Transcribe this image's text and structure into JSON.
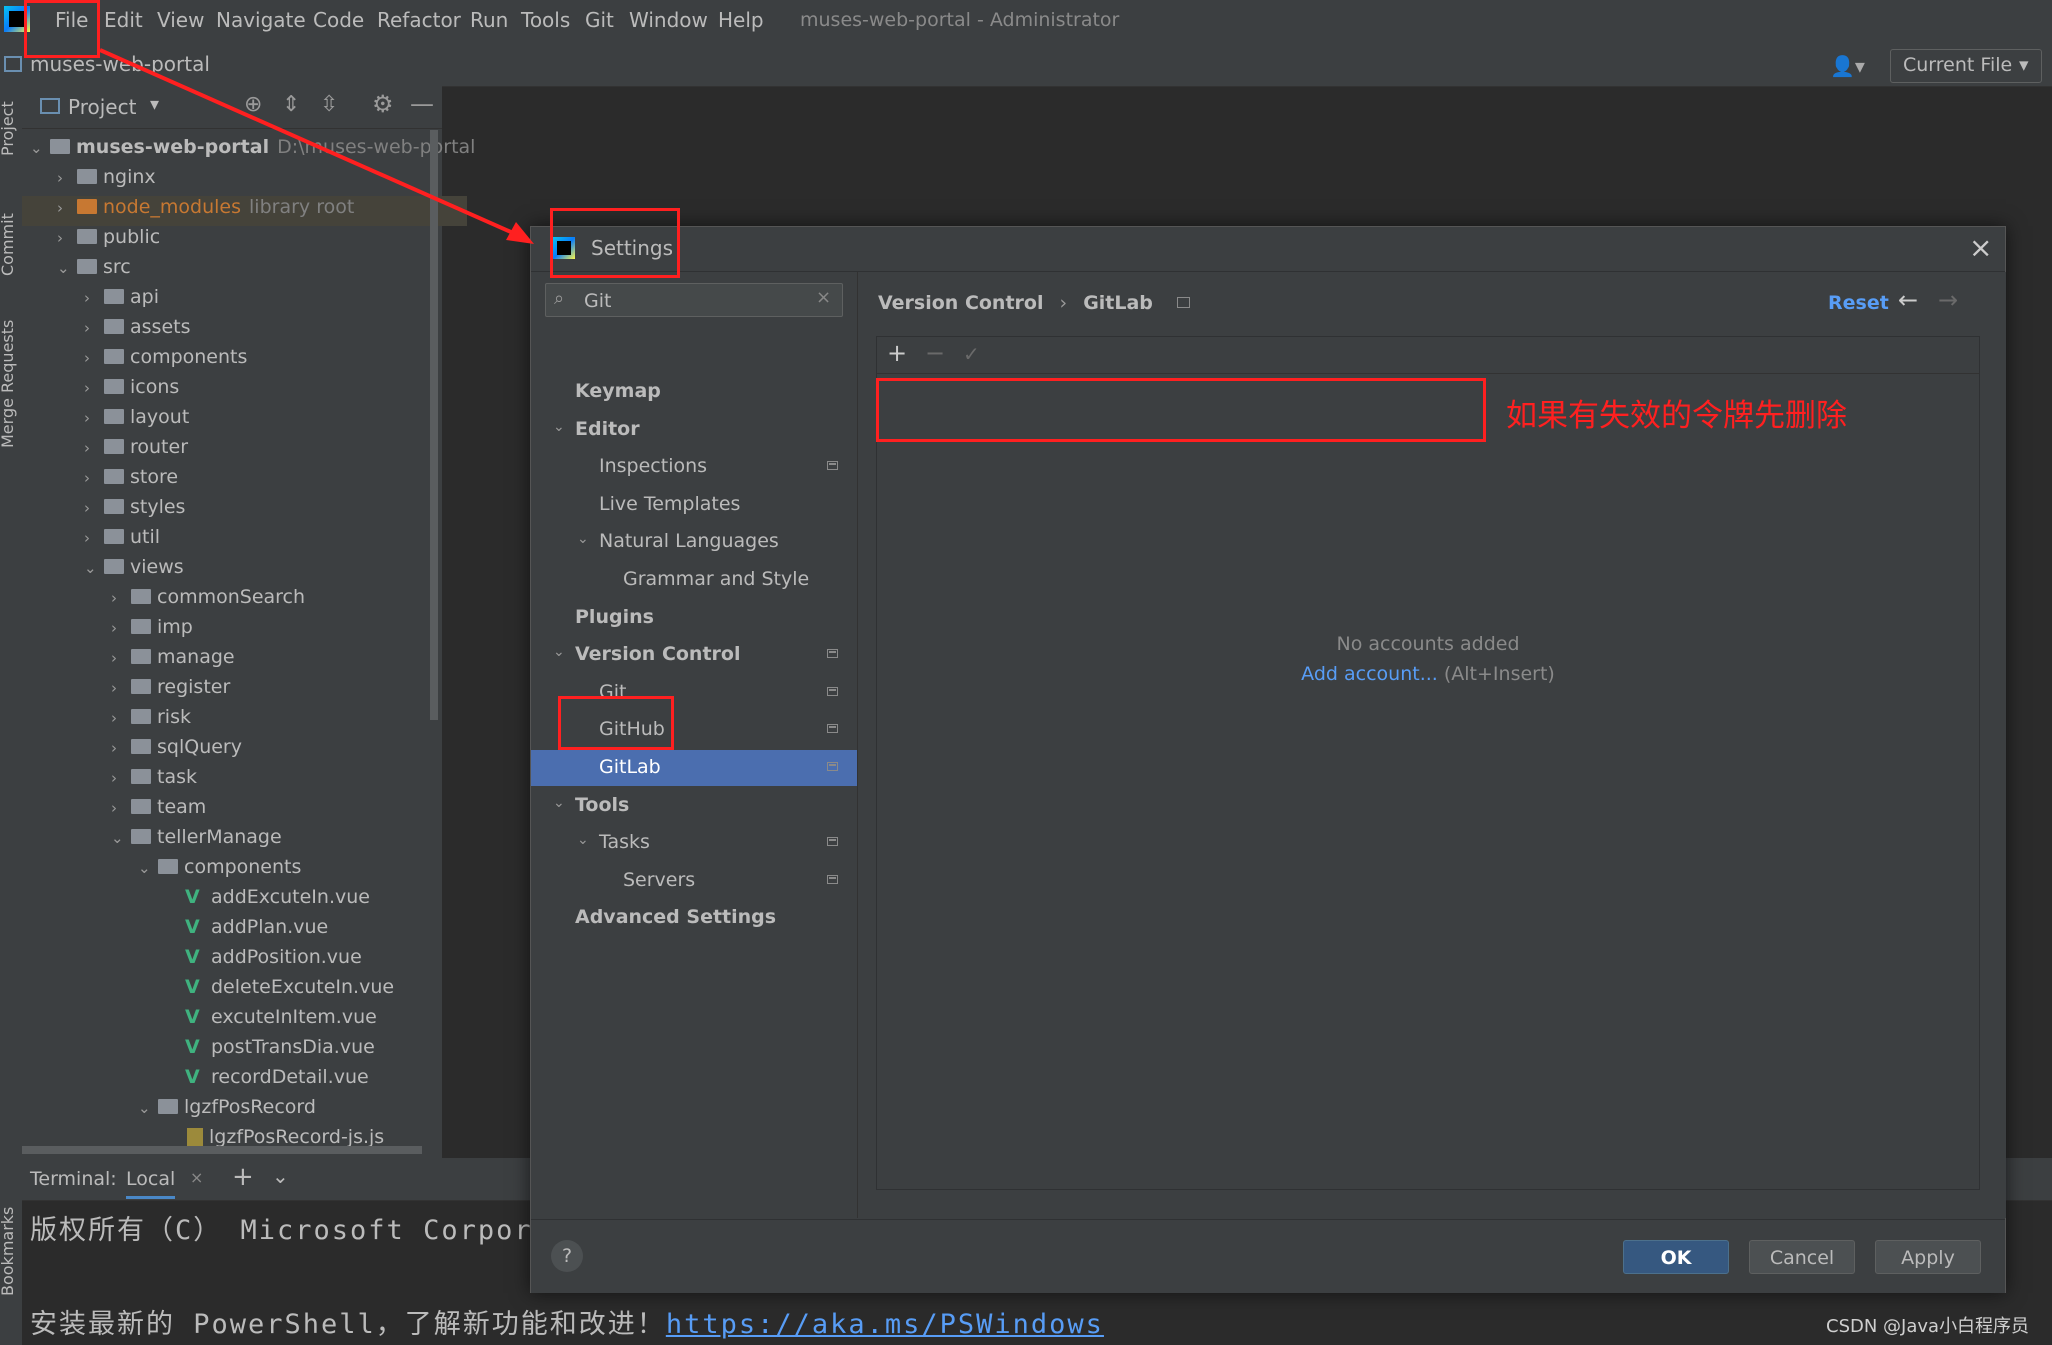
{
  "menubar": {
    "items": [
      "File",
      "Edit",
      "View",
      "Navigate",
      "Code",
      "Refactor",
      "Run",
      "Tools",
      "Git",
      "Window",
      "Help"
    ],
    "window_title": "muses-web-portal - Administrator"
  },
  "navbar": {
    "project": "muses-web-portal",
    "run_config": "Current File"
  },
  "toolstrip": {
    "tabs": [
      "Project",
      "Commit",
      "Merge Requests",
      "Bookmarks"
    ]
  },
  "project_panel": {
    "title": "Project",
    "tree": [
      {
        "label": "muses-web-portal",
        "hint": "D:\\muses-web-portal",
        "type": "folder",
        "expanded": true,
        "bold": true
      },
      {
        "label": "nginx",
        "type": "folder"
      },
      {
        "label": "node_modules",
        "hint": "library root",
        "type": "folder-orange"
      },
      {
        "label": "public",
        "type": "folder"
      },
      {
        "label": "src",
        "type": "folder",
        "expanded": true
      },
      {
        "label": "api",
        "type": "folder"
      },
      {
        "label": "assets",
        "type": "folder"
      },
      {
        "label": "components",
        "type": "folder"
      },
      {
        "label": "icons",
        "type": "folder"
      },
      {
        "label": "layout",
        "type": "folder"
      },
      {
        "label": "router",
        "type": "folder"
      },
      {
        "label": "store",
        "type": "folder"
      },
      {
        "label": "styles",
        "type": "folder"
      },
      {
        "label": "util",
        "type": "folder"
      },
      {
        "label": "views",
        "type": "folder",
        "expanded": true
      },
      {
        "label": "commonSearch",
        "type": "folder"
      },
      {
        "label": "imp",
        "type": "folder"
      },
      {
        "label": "manage",
        "type": "folder"
      },
      {
        "label": "register",
        "type": "folder"
      },
      {
        "label": "risk",
        "type": "folder"
      },
      {
        "label": "sqlQuery",
        "type": "folder"
      },
      {
        "label": "task",
        "type": "folder"
      },
      {
        "label": "team",
        "type": "folder"
      },
      {
        "label": "tellerManage",
        "type": "folder",
        "expanded": true
      },
      {
        "label": "components",
        "type": "folder",
        "expanded": true
      },
      {
        "label": "addExcuteIn.vue",
        "type": "vue"
      },
      {
        "label": "addPlan.vue",
        "type": "vue"
      },
      {
        "label": "addPosition.vue",
        "type": "vue"
      },
      {
        "label": "deleteExcuteIn.vue",
        "type": "vue"
      },
      {
        "label": "excuteInItem.vue",
        "type": "vue"
      },
      {
        "label": "postTransDia.vue",
        "type": "vue"
      },
      {
        "label": "recordDetail.vue",
        "type": "vue"
      },
      {
        "label": "lgzfPosRecord",
        "type": "folder",
        "expanded": true
      },
      {
        "label": "lgzfPosRecord-js.js",
        "type": "js"
      }
    ]
  },
  "terminal": {
    "label": "Terminal:",
    "tab": "Local",
    "line1": "版权所有（C） Microsoft Corpora",
    "line2_prefix": "安装最新的 PowerShell，了解新功能和改进！",
    "line2_link": "https://aka.ms/PSWindows"
  },
  "settings_dialog": {
    "title": "Settings",
    "search_value": "Git",
    "tree": [
      {
        "label": "Keymap",
        "bold": true,
        "indent": 0
      },
      {
        "label": "Editor",
        "bold": true,
        "indent": 0,
        "chevron": "down"
      },
      {
        "label": "Inspections",
        "indent": 1,
        "project_icon": true
      },
      {
        "label": "Live Templates",
        "indent": 1
      },
      {
        "label": "Natural Languages",
        "indent": 1,
        "chevron": "down"
      },
      {
        "label": "Grammar and Style",
        "indent": 2
      },
      {
        "label": "Plugins",
        "bold": true,
        "indent": 0
      },
      {
        "label": "Version Control",
        "bold": true,
        "indent": 0,
        "chevron": "down",
        "project_icon": true
      },
      {
        "label": "Git",
        "indent": 1,
        "project_icon": true
      },
      {
        "label": "GitHub",
        "indent": 1,
        "project_icon": true
      },
      {
        "label": "GitLab",
        "indent": 1,
        "project_icon": true,
        "selected": true
      },
      {
        "label": "Tools",
        "bold": true,
        "indent": 0,
        "chevron": "down"
      },
      {
        "label": "Tasks",
        "indent": 1,
        "chevron": "down",
        "project_icon": true
      },
      {
        "label": "Servers",
        "indent": 2,
        "project_icon": true
      },
      {
        "label": "Advanced Settings",
        "bold": true,
        "indent": 0
      }
    ],
    "breadcrumb": [
      "Version Control",
      "GitLab"
    ],
    "reset_label": "Reset",
    "empty_text": "No accounts added",
    "add_account_link": "Add account...",
    "add_account_shortcut": "(Alt+Insert)",
    "buttons": {
      "ok": "OK",
      "cancel": "Cancel",
      "apply": "Apply",
      "help": "?"
    }
  },
  "annotation": {
    "text": "如果有失效的令牌先删除",
    "color": "#ff2020"
  },
  "watermark": "CSDN @Java小白程序员",
  "colors": {
    "selection": "#4b6eaf",
    "link": "#589df6",
    "vue": "#3fb27f",
    "annotation": "#ff2020"
  },
  "icons": [
    "search-icon",
    "close-icon",
    "plus-icon",
    "minus-icon",
    "check-icon",
    "back-arrow-icon",
    "forward-arrow-icon",
    "gear-icon",
    "help-icon"
  ]
}
